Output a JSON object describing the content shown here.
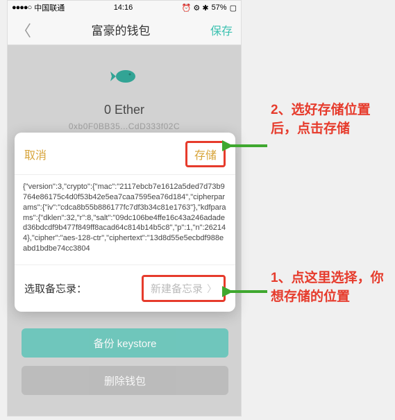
{
  "status": {
    "carrier": "中国联通",
    "signal": "●●●●○",
    "time": "14:16",
    "battery": "57%",
    "icons": "⏰ ⚙ ✱"
  },
  "nav": {
    "title": "富豪的钱包",
    "save": "保存"
  },
  "wallet": {
    "balance": "0 Ether",
    "address": "0xb0F0BB35...CdD333f02C"
  },
  "sheet": {
    "cancel": "取消",
    "store": "存储",
    "json_text": "{\"version\":3,\"crypto\":{\"mac\":\"2117ebcb7e1612a5ded7d73b9764e86175c4d0f53b42e5ea7caa7595ea76d184\",\"cipherparams\":{\"iv\":\"cdca8b55b886177fc7df3b34c81e1763\"},\"kdfparams\":{\"dklen\":32,\"r\":8,\"salt\":\"09dc106be4ffe16c43a246adaded36bdcdf9b477f849ff8acad64c814b14b5c8\",\"p\":1,\"n\":262144},\"cipher\":\"aes-128-ctr\",\"ciphertext\":\"13d8d55e5ecbdf988eabd1bdbe74cc3804",
    "memo_label": "选取备忘录：",
    "memo_button": "新建备忘录"
  },
  "buttons": {
    "backup": "备份 keystore",
    "delete": "删除钱包"
  },
  "annotations": {
    "a1": "1、点这里选择，你想存储的位置",
    "a2": "2、选好存储位置后，点击存储"
  },
  "colors": {
    "accent": "#3bc1b0",
    "highlight": "#e63b2c",
    "gold": "#d7a43a"
  }
}
